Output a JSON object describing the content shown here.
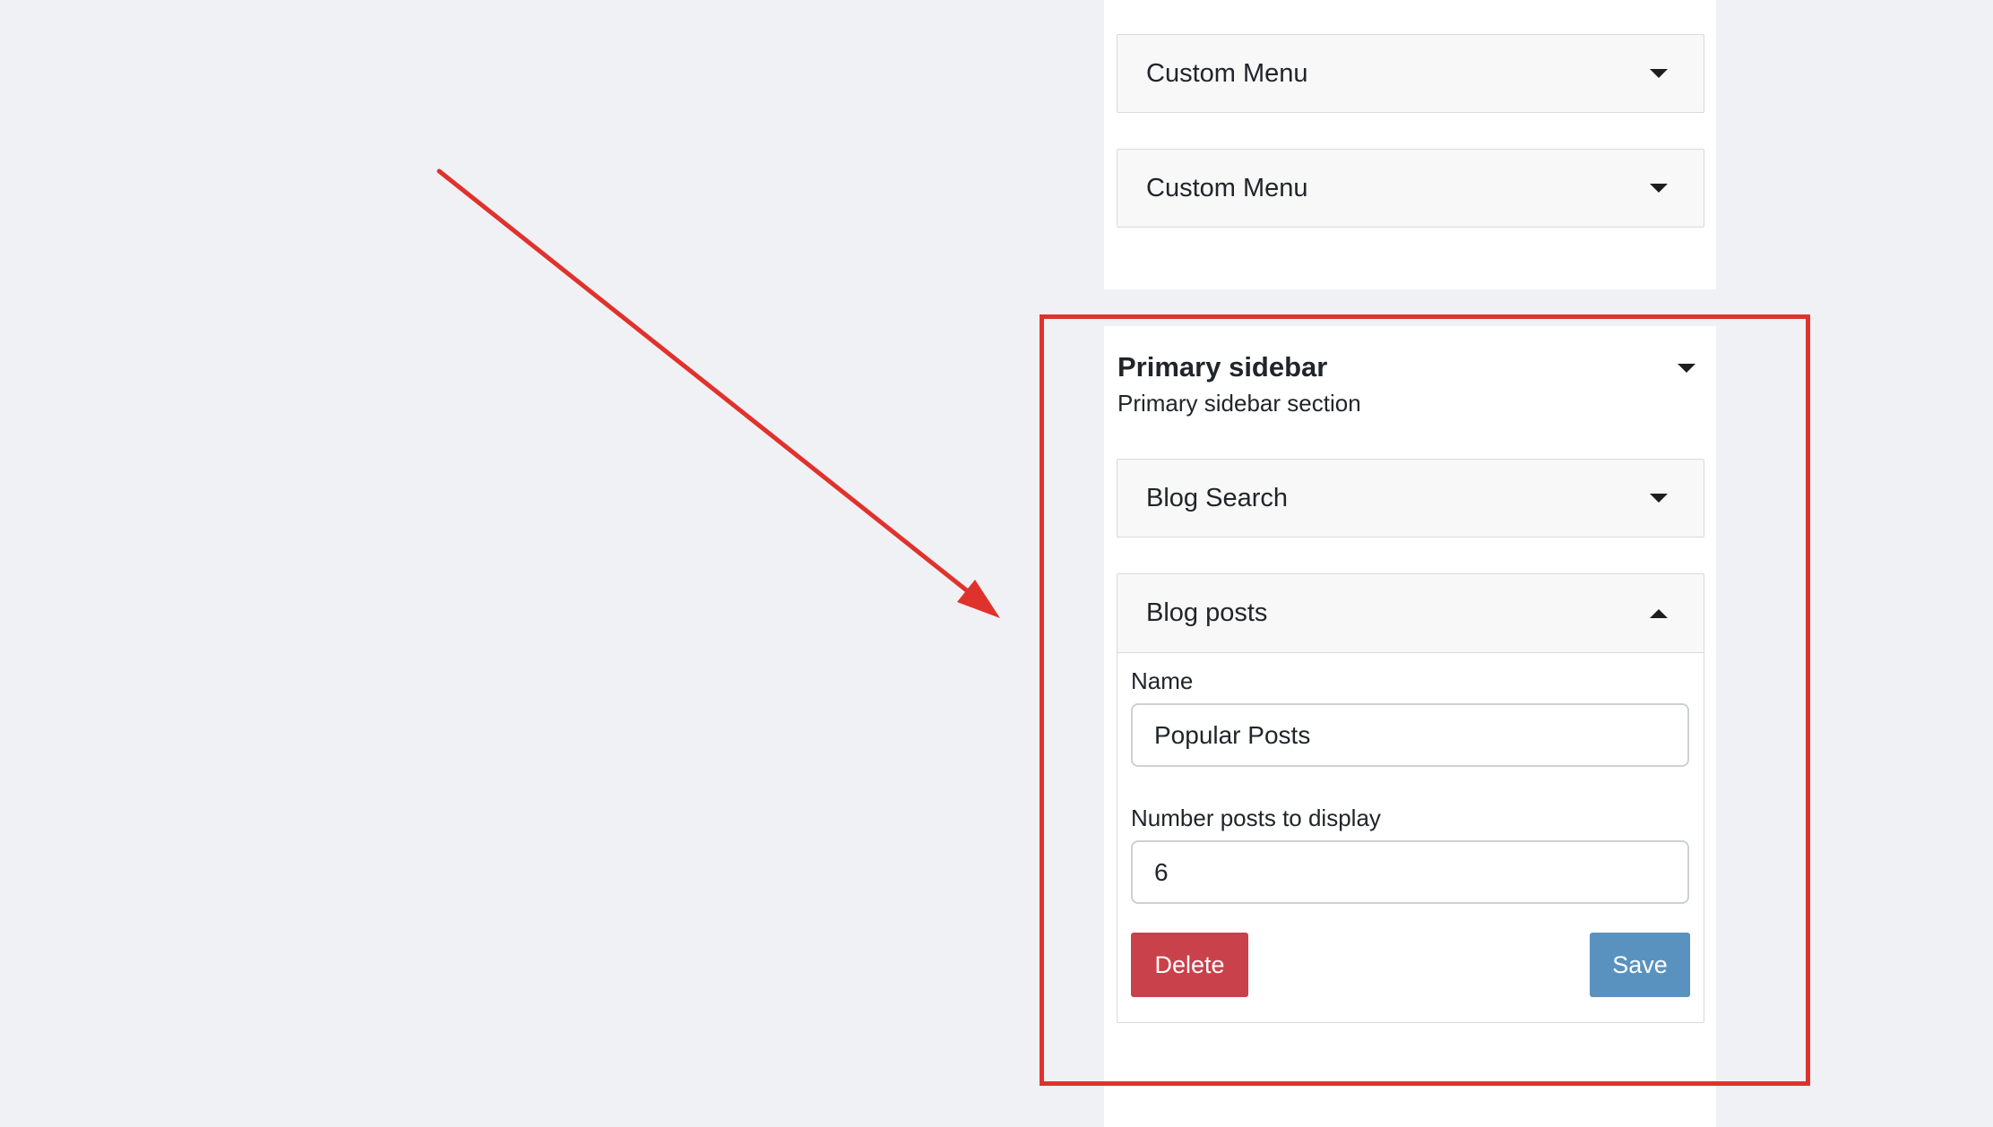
{
  "widgets_top": [
    {
      "title": "Custom Menu",
      "caret": "caret-down-icon"
    },
    {
      "title": "Custom Menu",
      "caret": "caret-down-icon"
    }
  ],
  "section": {
    "title": "Primary sidebar",
    "subtitle": "Primary sidebar section",
    "caret": "caret-down-icon"
  },
  "widgets_section": [
    {
      "title": "Blog Search",
      "caret": "caret-down-icon"
    }
  ],
  "expanded_widget": {
    "title": "Blog posts",
    "caret": "caret-up-icon",
    "fields": [
      {
        "label": "Name",
        "value": "Popular Posts"
      },
      {
        "label": "Number posts to display",
        "value": "6"
      }
    ],
    "delete_label": "Delete",
    "save_label": "Save"
  },
  "colors": {
    "background": "#f0f1f5",
    "panel": "#ffffff",
    "annotation": "#e0322c",
    "delete_button": "#c9414a",
    "save_button": "#5a92bf"
  }
}
